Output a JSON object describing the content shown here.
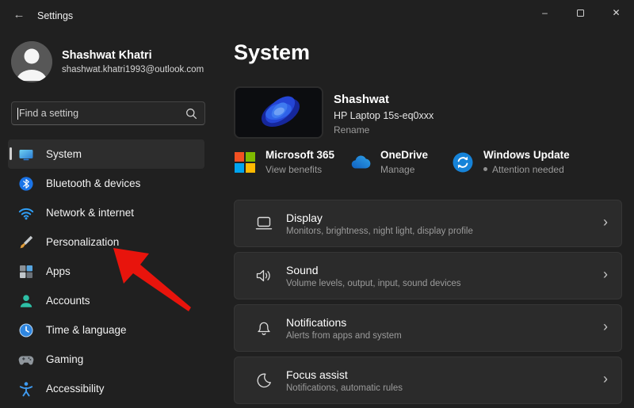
{
  "titlebar": {
    "title": "Settings",
    "back_glyph": "←",
    "minimize_glyph": "–",
    "close_glyph": "✕"
  },
  "profile": {
    "name": "Shashwat Khatri",
    "email": "shashwat.khatri1993@outlook.com"
  },
  "search": {
    "placeholder": "Find a setting",
    "icon": "search-icon"
  },
  "sidebar": {
    "items": [
      {
        "label": "System",
        "icon": "monitor-icon",
        "selected": true
      },
      {
        "label": "Bluetooth & devices",
        "icon": "bluetooth-icon",
        "selected": false
      },
      {
        "label": "Network & internet",
        "icon": "wifi-icon",
        "selected": false
      },
      {
        "label": "Personalization",
        "icon": "paintbrush-icon",
        "selected": false
      },
      {
        "label": "Apps",
        "icon": "apps-grid-icon",
        "selected": false
      },
      {
        "label": "Accounts",
        "icon": "person-icon",
        "selected": false
      },
      {
        "label": "Time & language",
        "icon": "clock-icon",
        "selected": false
      },
      {
        "label": "Gaming",
        "icon": "gamepad-icon",
        "selected": false
      },
      {
        "label": "Accessibility",
        "icon": "accessibility-icon",
        "selected": false
      }
    ]
  },
  "main": {
    "page_title": "System",
    "device": {
      "name": "Shashwat",
      "model": "HP Laptop 15s-eq0xxx",
      "rename_label": "Rename"
    },
    "status_cards": [
      {
        "title": "Microsoft 365",
        "subtitle": "View benefits",
        "icon": "microsoft-logo-icon"
      },
      {
        "title": "OneDrive",
        "subtitle": "Manage",
        "icon": "onedrive-cloud-icon"
      },
      {
        "title": "Windows Update",
        "subtitle": "Attention needed",
        "icon": "windows-update-icon",
        "has_dot": true
      }
    ],
    "settings_rows": [
      {
        "title": "Display",
        "subtitle": "Monitors, brightness, night light, display profile",
        "icon": "laptop-display-icon"
      },
      {
        "title": "Sound",
        "subtitle": "Volume levels, output, input, sound devices",
        "icon": "speaker-icon"
      },
      {
        "title": "Notifications",
        "subtitle": "Alerts from apps and system",
        "icon": "bell-icon"
      },
      {
        "title": "Focus assist",
        "subtitle": "Notifications, automatic rules",
        "icon": "moon-icon"
      }
    ],
    "chevron_glyph": "›"
  },
  "colors": {
    "background": "#202020",
    "card": "#2b2b2b",
    "text_secondary": "#9b9b9b",
    "ms_red": "#f25022",
    "ms_green": "#7fba00",
    "ms_blue": "#00a4ef",
    "ms_yellow": "#ffb900",
    "onedrive_blue": "#2088d8",
    "update_blue": "#1683d8",
    "arrow_red": "#e8140c"
  }
}
